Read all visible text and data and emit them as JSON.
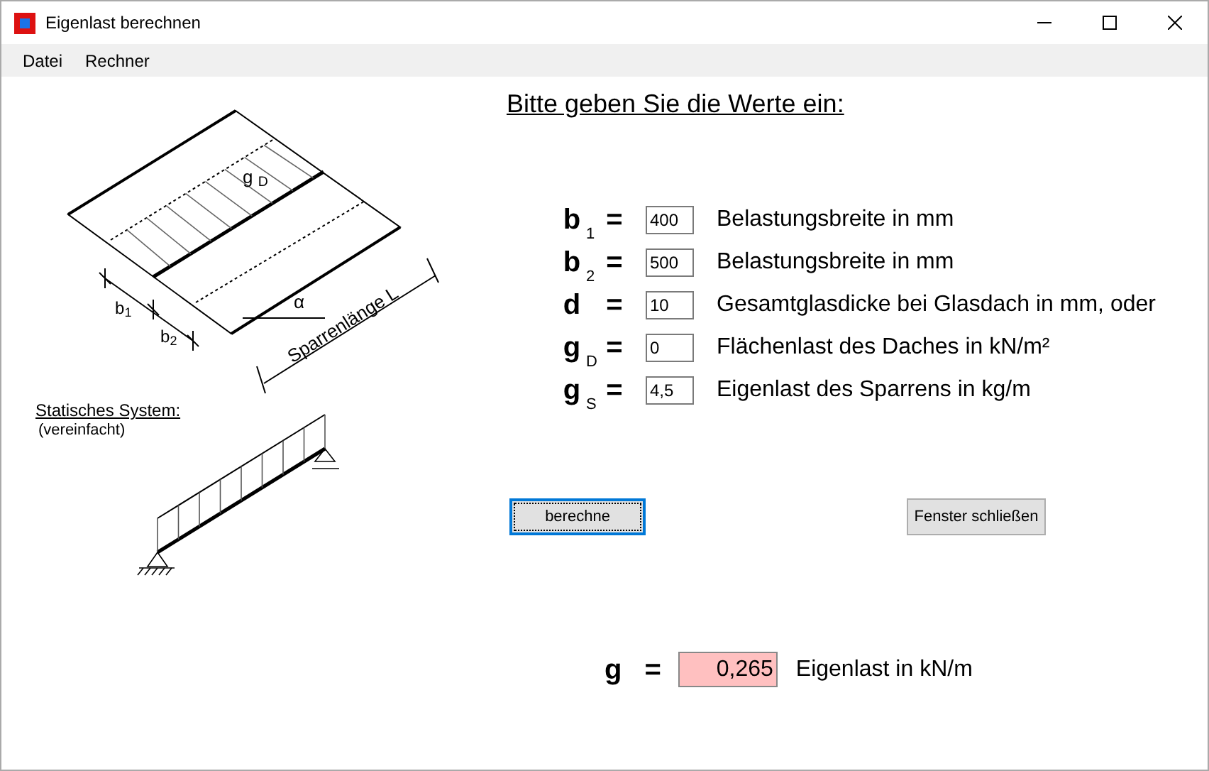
{
  "window": {
    "title": "Eigenlast berechnen"
  },
  "menu": [
    {
      "label": "Datei"
    },
    {
      "label": "Rechner"
    }
  ],
  "diagram": {
    "load_label": "g $_{D}$",
    "b1_label": "b$_{1}$",
    "b2_label": "b$_{2}$",
    "angle_label": "α",
    "length_label": "Sparrenlänge L",
    "system_title": "Statisches System:",
    "system_note": "(vereinfacht)"
  },
  "heading": "Bitte geben Sie die Werte ein:",
  "inputs": [
    {
      "symbol": "b",
      "sub": "1",
      "equals": "=",
      "value": "400",
      "description": "Belastungsbreite in mm"
    },
    {
      "symbol": "b",
      "sub": "2",
      "equals": "=",
      "value": "500",
      "description": "Belastungsbreite in mm"
    },
    {
      "symbol": "d",
      "equals": "=",
      "value": "10",
      "description": "Gesamtglasdicke bei Glasdach in mm, oder"
    },
    {
      "symbol": "g",
      "sub": "D",
      "equals": "=",
      "value": "0",
      "description": "Flächenlast des Daches in kN/m²"
    },
    {
      "symbol": "g",
      "sub": "S",
      "equals": "=",
      "value": "4,5",
      "description": "Eigenlast des Sparrens in kg/m"
    }
  ],
  "buttons": [
    {
      "label": "berechne",
      "focused": true
    },
    {
      "label": "Fenster schließen",
      "focused": false
    }
  ],
  "result": {
    "symbol": "g",
    "equals": "=",
    "value": "0,265",
    "description": "Eigenlast in kN/m"
  }
}
